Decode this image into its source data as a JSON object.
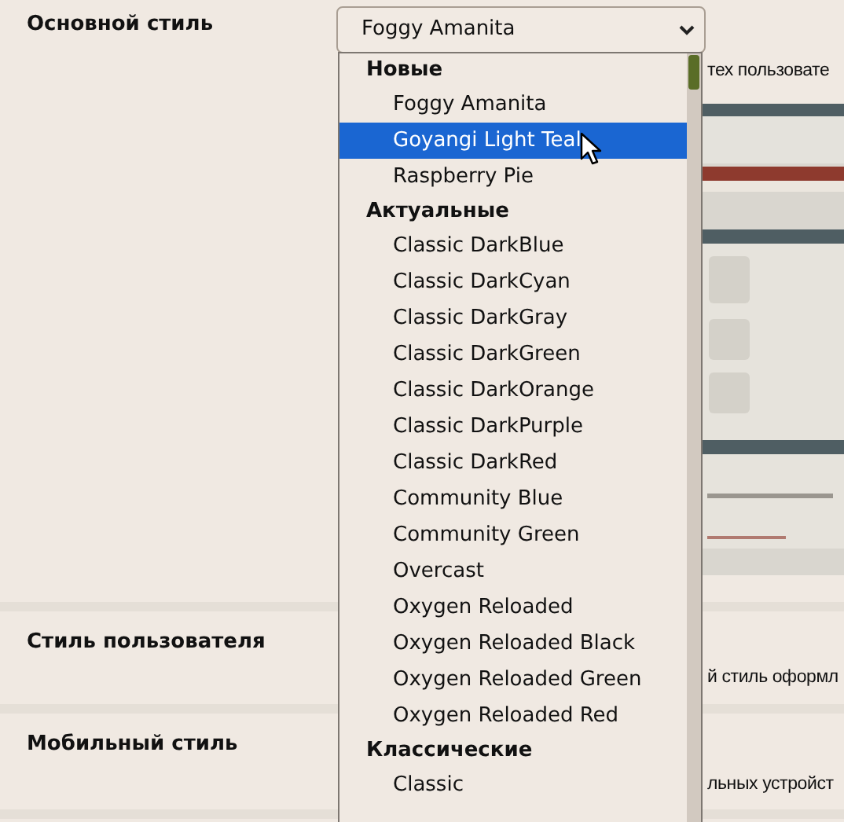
{
  "settings": [
    {
      "label": "Основной стиль",
      "select": {
        "value": "Foggy Amanita"
      },
      "description": "тех пользовате"
    },
    {
      "label": "Стиль пользователя",
      "description": "й стиль оформл"
    },
    {
      "label": "Мобильный стиль",
      "description": "льных устройст"
    }
  ],
  "dropdown": {
    "groups": [
      {
        "label": "Новые",
        "options": [
          {
            "label": "Foggy Amanita",
            "selected": false
          },
          {
            "label": "Goyangi Light Teal",
            "selected": true
          },
          {
            "label": "Raspberry Pie",
            "selected": false
          }
        ]
      },
      {
        "label": "Актуальные",
        "options": [
          {
            "label": "Classic DarkBlue",
            "selected": false
          },
          {
            "label": "Classic DarkCyan",
            "selected": false
          },
          {
            "label": "Classic DarkGray",
            "selected": false
          },
          {
            "label": "Classic DarkGreen",
            "selected": false
          },
          {
            "label": "Classic DarkOrange",
            "selected": false
          },
          {
            "label": "Classic DarkPurple",
            "selected": false
          },
          {
            "label": "Classic DarkRed",
            "selected": false
          },
          {
            "label": "Community Blue",
            "selected": false
          },
          {
            "label": "Community Green",
            "selected": false
          },
          {
            "label": "Overcast",
            "selected": false
          },
          {
            "label": "Oxygen Reloaded",
            "selected": false
          },
          {
            "label": "Oxygen Reloaded Black",
            "selected": false
          },
          {
            "label": "Oxygen Reloaded Green",
            "selected": false
          },
          {
            "label": "Oxygen Reloaded Red",
            "selected": false
          }
        ]
      },
      {
        "label": "Классические",
        "options": [
          {
            "label": "Classic",
            "selected": false
          }
        ]
      }
    ]
  }
}
